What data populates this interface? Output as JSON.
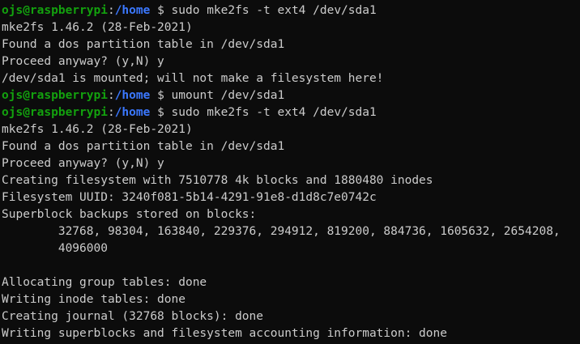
{
  "colors": {
    "background": "#0c0c0c",
    "text": "#cccccc",
    "user_host": "#13a10e",
    "path": "#3b78ff"
  },
  "lines": [
    {
      "type": "prompt",
      "user": "ojs@raspberrypi",
      "sep": ":",
      "path": "/home",
      "dollar": " $ ",
      "cmd": "sudo mke2fs -t ext4 /dev/sda1"
    },
    {
      "type": "output",
      "text": "mke2fs 1.46.2 (28-Feb-2021)"
    },
    {
      "type": "output",
      "text": "Found a dos partition table in /dev/sda1"
    },
    {
      "type": "output",
      "text": "Proceed anyway? (y,N) y"
    },
    {
      "type": "output",
      "text": "/dev/sda1 is mounted; will not make a filesystem here!"
    },
    {
      "type": "prompt",
      "user": "ojs@raspberrypi",
      "sep": ":",
      "path": "/home",
      "dollar": " $ ",
      "cmd": "umount /dev/sda1"
    },
    {
      "type": "prompt",
      "user": "ojs@raspberrypi",
      "sep": ":",
      "path": "/home",
      "dollar": " $ ",
      "cmd": "sudo mke2fs -t ext4 /dev/sda1"
    },
    {
      "type": "output",
      "text": "mke2fs 1.46.2 (28-Feb-2021)"
    },
    {
      "type": "output",
      "text": "Found a dos partition table in /dev/sda1"
    },
    {
      "type": "output",
      "text": "Proceed anyway? (y,N) y"
    },
    {
      "type": "output",
      "text": "Creating filesystem with 7510778 4k blocks and 1880480 inodes"
    },
    {
      "type": "output",
      "text": "Filesystem UUID: 3240f081-5b14-4291-91e8-d1d8c7e0742c"
    },
    {
      "type": "output",
      "text": "Superblock backups stored on blocks:"
    },
    {
      "type": "output",
      "text": "        32768, 98304, 163840, 229376, 294912, 819200, 884736, 1605632, 2654208,"
    },
    {
      "type": "output",
      "text": "        4096000"
    },
    {
      "type": "output",
      "text": ""
    },
    {
      "type": "output",
      "text": "Allocating group tables: done"
    },
    {
      "type": "output",
      "text": "Writing inode tables: done"
    },
    {
      "type": "output",
      "text": "Creating journal (32768 blocks): done"
    },
    {
      "type": "output",
      "text": "Writing superblocks and filesystem accounting information: done"
    }
  ]
}
